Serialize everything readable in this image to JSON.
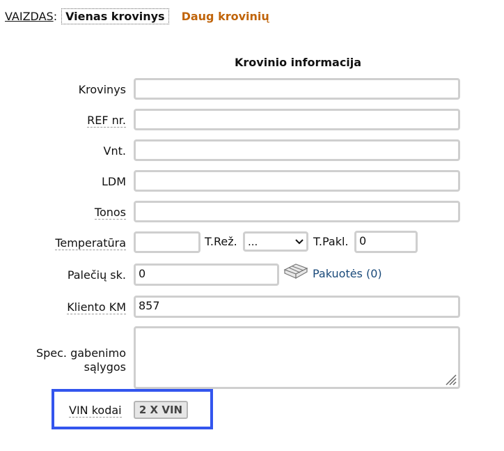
{
  "view": {
    "label": "VAIZDAS",
    "colon": ":",
    "tabs": [
      {
        "label": "Vienas krovinys"
      },
      {
        "label": "Daug krovinių"
      }
    ]
  },
  "section": {
    "title": "Krovinio informacija"
  },
  "fields": {
    "krovinys": {
      "label": "Krovinys",
      "value": ""
    },
    "ref": {
      "label": "REF nr.",
      "value": ""
    },
    "vnt": {
      "label": "Vnt.",
      "value": ""
    },
    "ldm": {
      "label": "LDM",
      "value": ""
    },
    "tonos": {
      "label": "Tonos",
      "value": ""
    },
    "temperatura": {
      "label": "Temperatūra",
      "value": ""
    },
    "trez": {
      "label": "T.Rež.",
      "selected": "..."
    },
    "tpakl": {
      "label": "T.Pakl.",
      "value": "0"
    },
    "paleciu": {
      "label": "Palečių sk.",
      "value": "0"
    },
    "pakuotes_link": "Pakuotės (0)",
    "kliento_km": {
      "label": "Kliento KM",
      "value": "857"
    },
    "spec_line1": "Spec. gabenimo",
    "spec_line2": "sąlygos",
    "spec_value": ""
  },
  "vin": {
    "label": "VIN kodai",
    "button": "2 X VIN",
    "highlight_color": "#3355ee"
  },
  "colors": {
    "accent_tab": "#c0640a",
    "link": "#1a4a7a",
    "field_border": "#cfcfcf"
  }
}
